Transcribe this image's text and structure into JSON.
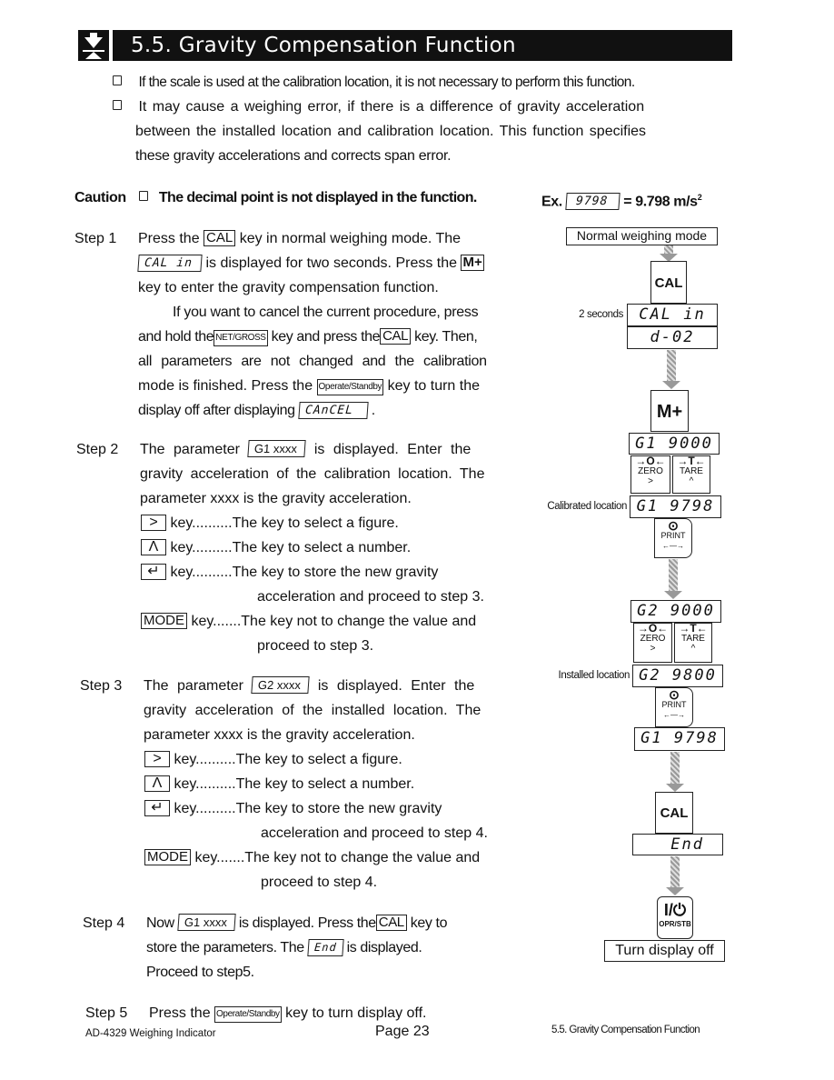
{
  "header": {
    "icon": "download-arrow-icon",
    "title": "5.5.  Gravity Compensation Function"
  },
  "intro": {
    "bullet1": "If the scale is used at the calibration location, it is not necessary to perform this function.",
    "bullet2_line1": "It may cause a weighing error, if there is a difference of gravity acceleration",
    "bullet2_line2": "between the installed location and calibration location. This function specifies",
    "bullet2_line3": "these gravity accelerations and corrects span error."
  },
  "caution": {
    "label": "Caution",
    "text": "The decimal point is not displayed in the function.",
    "ex_label": "Ex.",
    "ex_display": "9798",
    "ex_value": "= 9.798 m/s",
    "ex_sup": "2"
  },
  "step1": {
    "label": "Step 1",
    "l1a": "Press the",
    "key_cal": "CAL",
    "l1b": "key in normal weighing mode. The",
    "disp_calin": "CAL  in",
    "l2b": "is displayed for two seconds. Press the",
    "key_mplus": "M+",
    "l3": "key to enter the gravity compensation function.",
    "l4": "If you want to cancel the current procedure, press",
    "l5a": "and hold the",
    "key_netgross": "NET/GROSS",
    "l5b": "key and press the",
    "l5c": "key. Then,",
    "l6": "all parameters are not changed and the calibration",
    "l7a": "mode is finished. Press the",
    "key_opstby": "Operate/Standby",
    "l7b": "key to turn the",
    "l8a": "display off after displaying",
    "disp_cancel": "CAnCEL",
    "l8b": "."
  },
  "step2": {
    "label": "Step 2",
    "l1a": "The parameter",
    "disp": "G1 xxxx",
    "l1b": "is displayed. Enter the",
    "l2": "gravity acceleration of the calibration location. The",
    "l3": "parameter xxxx is the gravity acceleration.",
    "keys": [
      {
        "sym": ">",
        "dots": "key..........",
        "desc": "The key to select a figure."
      },
      {
        "sym": "Λ",
        "dots": "key..........",
        "desc": "The key to select a number."
      },
      {
        "sym": "↵",
        "dots": "key..........",
        "desc": "The key to store the new gravity",
        "desc2": "acceleration and proceed to step 3."
      },
      {
        "sym": "MODE",
        "dots": "key.......",
        "desc": "The key not to change the value and",
        "desc2": "proceed to step 3."
      }
    ]
  },
  "step3": {
    "label": "Step 3",
    "l1a": "The parameter",
    "disp": "G2 xxxx",
    "l1b": "is displayed. Enter the",
    "l2": "gravity acceleration of the installed location. The",
    "l3": "parameter xxxx is the gravity acceleration.",
    "keys": [
      {
        "sym": ">",
        "dots": "key..........",
        "desc": "The key to select a figure."
      },
      {
        "sym": "Λ",
        "dots": "key..........",
        "desc": "The key to select a number."
      },
      {
        "sym": "↵",
        "dots": "key..........",
        "desc": "The key to store the new gravity",
        "desc2": "acceleration and proceed to step 4."
      },
      {
        "sym": "MODE",
        "dots": "key.......",
        "desc": "The key not to change the value and",
        "desc2": "proceed to step 4."
      }
    ]
  },
  "step4": {
    "label": "Step 4",
    "l1a": "Now",
    "disp": "G1 xxxx",
    "l1b": "is displayed. Press the",
    "key_cal": "CAL",
    "l1c": "key to",
    "l2a": "store the parameters. The",
    "disp_end": "End",
    "l2b": "is displayed.",
    "l3": "Proceed to step5."
  },
  "step5": {
    "label": "Step 5",
    "l1a": "Press the",
    "key_opstby": "Operate/Standby",
    "l1b": "key to turn display off."
  },
  "flow": {
    "start": "Normal weighing mode",
    "key_cal": "CAL",
    "label_2sec": "2 seconds",
    "disp_calin": "CAL  in",
    "disp_d02": "d-02",
    "key_mplus": "M+",
    "disp_g1_9000": "G1 9000",
    "zero_icon": "→O←",
    "zero_label": "ZERO",
    "zero_sub": ">",
    "tare_icon": "→T←",
    "tare_label": "TARE",
    "tare_sub": "^",
    "label_calibrated": "Calibrated location",
    "disp_g1_9798": "G1 9798",
    "print_icon": "⊙",
    "print_label": "PRINT",
    "print_sub": "←—→",
    "disp_g2_9000": "G2 9000",
    "label_installed": "Installed location",
    "disp_g2_9800": "G2 9800",
    "disp_g1_9798b": "G1 9798",
    "key_cal2": "CAL",
    "disp_end": "End",
    "power_icon": "I/⏻",
    "power_label": "OPR/STB",
    "end": "Turn display off"
  },
  "footer": {
    "left": "AD-4329 Weighing Indicator",
    "center": "Page 23",
    "right": "5.5. Gravity Compensation Function"
  }
}
